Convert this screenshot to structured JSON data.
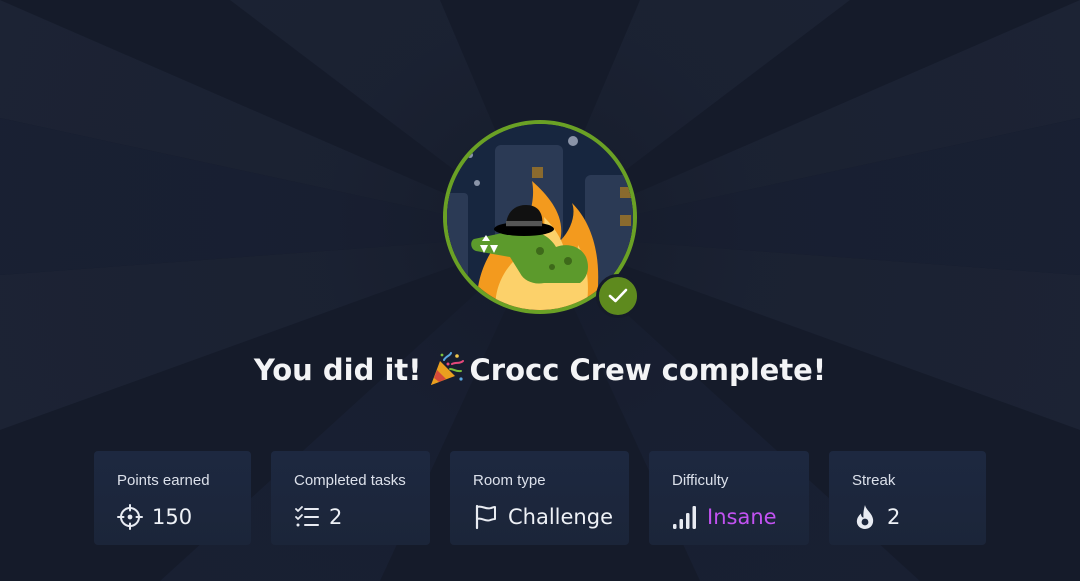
{
  "headline": {
    "prefix": "You did it!",
    "suffix": "Crocc Crew complete!",
    "party_icon": "party-popper-icon"
  },
  "badge": {
    "image": "crocc-crew-room-badge",
    "status_icon": "checkmark-icon",
    "ring_color": "#6aa125",
    "check_color": "#5e8a1e"
  },
  "stats": [
    {
      "label": "Points earned",
      "value": "150",
      "icon": "crosshair-icon"
    },
    {
      "label": "Completed tasks",
      "value": "2",
      "icon": "checklist-icon"
    },
    {
      "label": "Room type",
      "value": "Challenge",
      "icon": "flag-icon"
    },
    {
      "label": "Difficulty",
      "value": "Insane",
      "icon": "signal-bars-icon",
      "value_color": "#c252f2"
    },
    {
      "label": "Streak",
      "value": "2",
      "icon": "flame-icon"
    }
  ],
  "colors": {
    "background": "#151b2a",
    "card": "#1c273d",
    "difficulty_insane": "#c252f2"
  }
}
